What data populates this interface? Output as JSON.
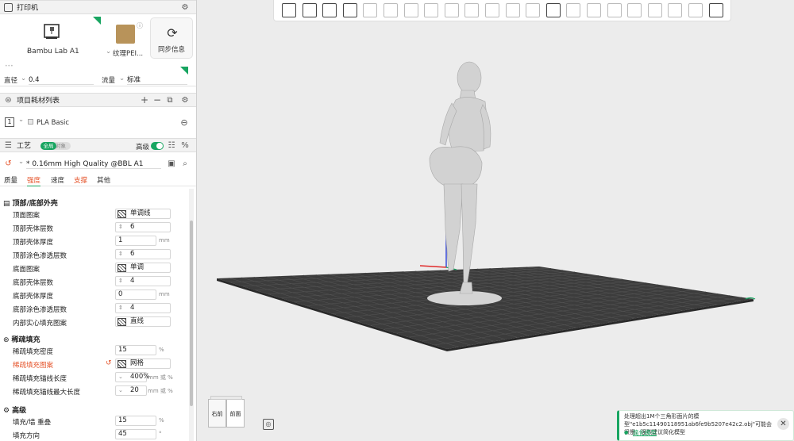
{
  "printer": {
    "header": "打印机",
    "name": "Bambu Lab A1",
    "plate": "纹理PEI...",
    "sync_label": "同步信息",
    "nozzle_label": "直径",
    "nozzle_value": "0.4",
    "flow_label": "流量",
    "flow_value": "标准"
  },
  "filaments": {
    "header": "项目耗材列表",
    "items": [
      {
        "index": "1",
        "name": "PLA Basic",
        "color": "#e8e8e8"
      }
    ]
  },
  "process": {
    "header": "工艺",
    "toggle_global": "全局",
    "toggle_object": "对象",
    "advanced_label": "高级",
    "preset": "* 0.16mm High Quality @BBL A1",
    "tabs": [
      "质量",
      "强度",
      "速度",
      "支撑",
      "其他"
    ],
    "active_tab": 1
  },
  "sections": {
    "shell": "顶部/底部外壳",
    "infill": "稀疏填充",
    "advanced": "高级"
  },
  "shell_rows": [
    {
      "label": "顶面图案",
      "value": "单调线",
      "kind": "pattern"
    },
    {
      "label": "顶部壳体层数",
      "value": "6",
      "kind": "spin"
    },
    {
      "label": "顶部壳体厚度",
      "value": "1",
      "unit": "mm",
      "kind": "plain"
    },
    {
      "label": "顶部涂色渗透层数",
      "value": "6",
      "kind": "spin"
    },
    {
      "label": "底面图案",
      "value": "单调",
      "kind": "pattern"
    },
    {
      "label": "底部壳体层数",
      "value": "4",
      "kind": "spin"
    },
    {
      "label": "底部壳体厚度",
      "value": "0",
      "unit": "mm",
      "kind": "plain"
    },
    {
      "label": "底部涂色渗透层数",
      "value": "4",
      "kind": "spin"
    },
    {
      "label": "内部实心填充图案",
      "value": "直线",
      "kind": "pattern"
    }
  ],
  "infill_rows": [
    {
      "label": "稀疏填充密度",
      "value": "15",
      "unit": "%",
      "kind": "plain"
    },
    {
      "label": "稀疏填充图案",
      "value": "网格",
      "kind": "pattern",
      "modified": true
    },
    {
      "label": "稀疏填充锚线长度",
      "value": "400%",
      "unit": "mm 或 %",
      "kind": "drop"
    },
    {
      "label": "稀疏填充锚线最大长度",
      "value": "20",
      "unit": "mm 或 %",
      "kind": "drop"
    }
  ],
  "advanced_rows": [
    {
      "label": "填充/墙 重叠",
      "value": "15",
      "unit": "%",
      "kind": "plain"
    },
    {
      "label": "填充方向",
      "value": "45",
      "unit": "°",
      "kind": "plain"
    }
  ],
  "viewcube": {
    "right": "右前",
    "front": "前面"
  },
  "notification": {
    "message": "处理超出1M个三角形面片的模型\"e1b5c11490118951ab6fe9b5207e42c2.obj\"可能会很慢，强烈建议简化模型",
    "link": "简化模型"
  },
  "colors": {
    "accent": "#18a561",
    "modified": "#e5542b",
    "bed": "#3c3c3c"
  }
}
